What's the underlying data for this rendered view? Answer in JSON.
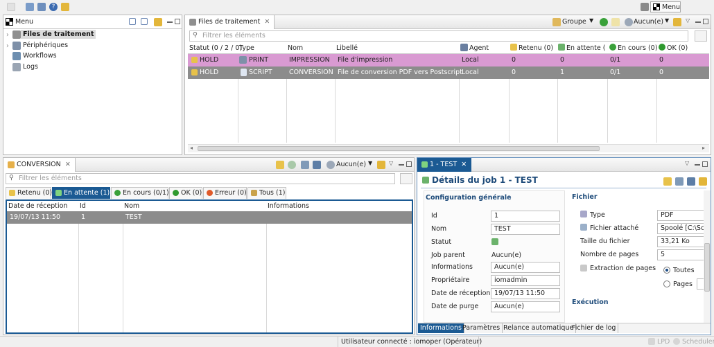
{
  "toolbar": {
    "menu_label": "Menu"
  },
  "nav": {
    "title": "Menu",
    "items": [
      "Files de traitement",
      "Périphériques",
      "Workflows",
      "Logs"
    ]
  },
  "queues": {
    "tab_title": "Files de traitement",
    "group_label": "Groupe",
    "filter_value": "Aucun(e)",
    "filter_placeholder": "Filtrer les éléments",
    "columns": [
      "Statut (0 / 2 / 0)",
      "Type",
      "Nom",
      "Libellé",
      "Agent",
      "Retenu (0)",
      "En attente (",
      "En cours (0)",
      "OK (0)"
    ],
    "rows": [
      {
        "status": "HOLD",
        "type": "PRINT",
        "name": "IMPRESSION",
        "label": "File d'impression",
        "agent": "Local",
        "held": "0",
        "waiting": "0",
        "running": "0/1",
        "ok": "0",
        "bg": "#d99ad2"
      },
      {
        "status": "HOLD",
        "type": "SCRIPT",
        "name": "CONVERSION",
        "label": "File de conversion PDF vers Postscript",
        "agent": "Local",
        "held": "0",
        "waiting": "1",
        "running": "0/1",
        "ok": "0",
        "bg": "#8c8c8c"
      }
    ]
  },
  "conversion": {
    "tab_title": "CONVERSION",
    "filter_value": "Aucun(e)",
    "filter_placeholder": "Filtrer les éléments",
    "subtabs": [
      "Retenu (0)",
      "En attente (1)",
      "En cours (0/1)",
      "OK (0)",
      "Erreur (0)",
      "Tous (1)"
    ],
    "columns": [
      "Date de réception",
      "Id",
      "Nom",
      "Informations"
    ],
    "rows": [
      {
        "date": "19/07/13 11:50",
        "id": "1",
        "name": "TEST",
        "info": ""
      }
    ]
  },
  "details": {
    "tab_title": "1 - TEST",
    "heading": "Détails du job 1 - TEST",
    "general": {
      "title": "Configuration générale",
      "fields": [
        {
          "label": "Id",
          "value": "1",
          "boxed": true
        },
        {
          "label": "Nom",
          "value": "TEST",
          "boxed": true
        },
        {
          "label": "Statut",
          "value": "",
          "boxed": false
        },
        {
          "label": "Job parent",
          "value": "Aucun(e)",
          "boxed": false
        },
        {
          "label": "Informations",
          "value": "Aucun(e)",
          "boxed": true
        },
        {
          "label": "Propriétaire",
          "value": "iomadmin",
          "boxed": true
        },
        {
          "label": "Date de réception",
          "value": "19/07/13 11:50",
          "boxed": true
        },
        {
          "label": "Date de purge",
          "value": "Aucun(e)",
          "boxed": true
        }
      ]
    },
    "file": {
      "title": "Fichier",
      "fields": [
        {
          "label": "Type",
          "value": "PDF"
        },
        {
          "label": "Fichier attaché",
          "value": "Spoolé [C:\\Sco"
        },
        {
          "label": "Taille du fichier",
          "value": "33,21 Ko"
        },
        {
          "label": "Nombre de pages",
          "value": "5"
        }
      ],
      "extraction_label": "Extraction de pages",
      "opt_all": "Toutes",
      "opt_pages": "Pages"
    },
    "execution_title": "Exécution",
    "bottom_tabs": [
      "Informations",
      "Paramètres",
      "Relance automatique",
      "Fichier de log"
    ]
  },
  "status": {
    "user": "Utilisateur connecté : iomoper (Opérateur)",
    "lpd": "LPD",
    "scheduler": "Scheduler"
  }
}
